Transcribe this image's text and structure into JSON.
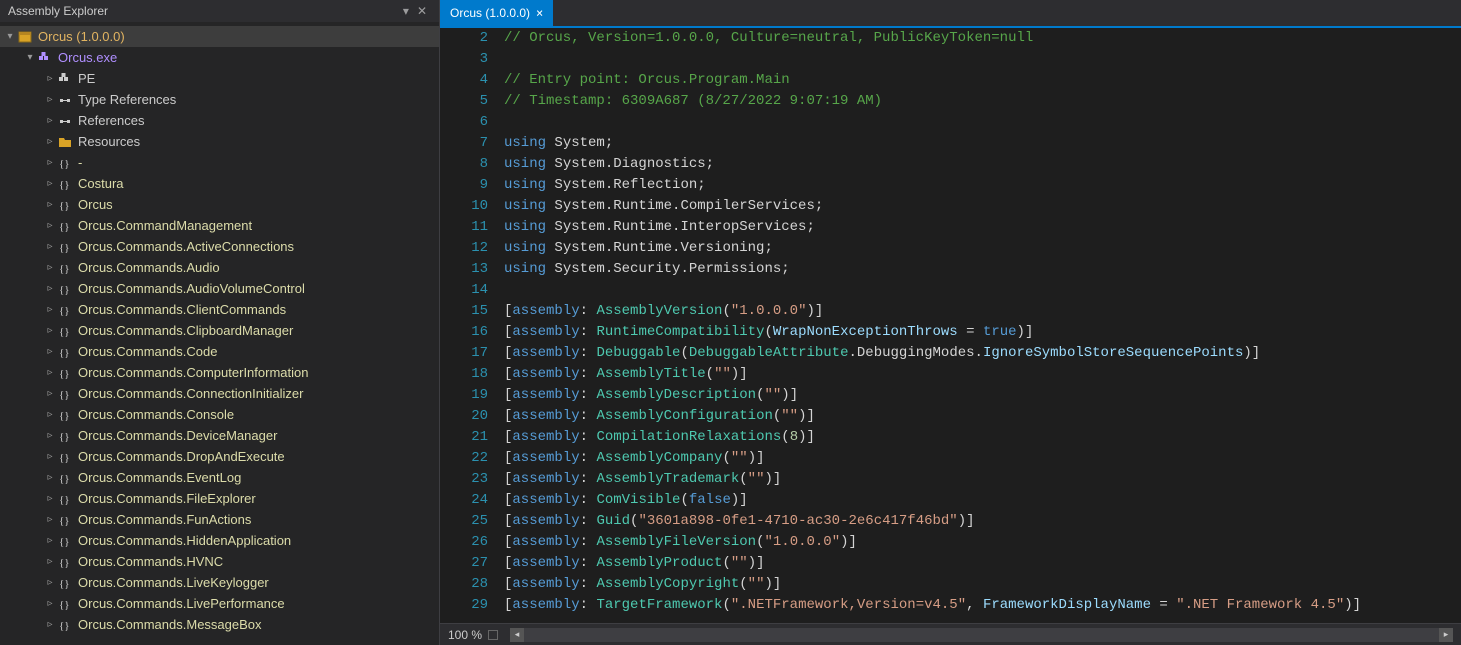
{
  "explorer": {
    "title": "Assembly Explorer",
    "root": {
      "label": "Orcus (1.0.0.0)",
      "exe": "Orcus.exe",
      "children": [
        {
          "label": "PE",
          "kind": "pe"
        },
        {
          "label": "Type References",
          "kind": "ref"
        },
        {
          "label": "References",
          "kind": "ref"
        },
        {
          "label": "Resources",
          "kind": "folder"
        },
        {
          "label": "-",
          "kind": "ns"
        },
        {
          "label": "Costura",
          "kind": "ns"
        },
        {
          "label": "Orcus",
          "kind": "ns"
        },
        {
          "label": "Orcus.CommandManagement",
          "kind": "ns"
        },
        {
          "label": "Orcus.Commands.ActiveConnections",
          "kind": "ns"
        },
        {
          "label": "Orcus.Commands.Audio",
          "kind": "ns"
        },
        {
          "label": "Orcus.Commands.AudioVolumeControl",
          "kind": "ns"
        },
        {
          "label": "Orcus.Commands.ClientCommands",
          "kind": "ns"
        },
        {
          "label": "Orcus.Commands.ClipboardManager",
          "kind": "ns"
        },
        {
          "label": "Orcus.Commands.Code",
          "kind": "ns"
        },
        {
          "label": "Orcus.Commands.ComputerInformation",
          "kind": "ns"
        },
        {
          "label": "Orcus.Commands.ConnectionInitializer",
          "kind": "ns"
        },
        {
          "label": "Orcus.Commands.Console",
          "kind": "ns"
        },
        {
          "label": "Orcus.Commands.DeviceManager",
          "kind": "ns"
        },
        {
          "label": "Orcus.Commands.DropAndExecute",
          "kind": "ns"
        },
        {
          "label": "Orcus.Commands.EventLog",
          "kind": "ns"
        },
        {
          "label": "Orcus.Commands.FileExplorer",
          "kind": "ns"
        },
        {
          "label": "Orcus.Commands.FunActions",
          "kind": "ns"
        },
        {
          "label": "Orcus.Commands.HiddenApplication",
          "kind": "ns"
        },
        {
          "label": "Orcus.Commands.HVNC",
          "kind": "ns"
        },
        {
          "label": "Orcus.Commands.LiveKeylogger",
          "kind": "ns"
        },
        {
          "label": "Orcus.Commands.LivePerformance",
          "kind": "ns"
        },
        {
          "label": "Orcus.Commands.MessageBox",
          "kind": "ns"
        }
      ]
    }
  },
  "tab": {
    "label": "Orcus (1.0.0.0)"
  },
  "status": {
    "zoom": "100 %"
  },
  "code": [
    {
      "n": 2,
      "t": "comment",
      "text": "// Orcus, Version=1.0.0.0, Culture=neutral, PublicKeyToken=null"
    },
    {
      "n": 3,
      "t": "blank",
      "text": ""
    },
    {
      "n": 4,
      "t": "comment",
      "text": "// Entry point: Orcus.Program.Main"
    },
    {
      "n": 5,
      "t": "comment",
      "text": "// Timestamp: 6309A687 (8/27/2022 9:07:19 AM)"
    },
    {
      "n": 6,
      "t": "blank",
      "text": ""
    },
    {
      "n": 7,
      "t": "using",
      "ns": "System"
    },
    {
      "n": 8,
      "t": "using",
      "ns": "System.Diagnostics"
    },
    {
      "n": 9,
      "t": "using",
      "ns": "System.Reflection"
    },
    {
      "n": 10,
      "t": "using",
      "ns": "System.Runtime.CompilerServices"
    },
    {
      "n": 11,
      "t": "using",
      "ns": "System.Runtime.InteropServices"
    },
    {
      "n": 12,
      "t": "using",
      "ns": "System.Runtime.Versioning"
    },
    {
      "n": 13,
      "t": "using",
      "ns": "System.Security.Permissions"
    },
    {
      "n": 14,
      "t": "blank",
      "text": ""
    },
    {
      "n": 15,
      "t": "attr",
      "name": "AssemblyVersion",
      "args": [
        {
          "k": "str",
          "v": "\"1.0.0.0\""
        }
      ]
    },
    {
      "n": 16,
      "t": "attr",
      "name": "RuntimeCompatibility",
      "args": [
        {
          "k": "assign",
          "param": "WrapNonExceptionThrows",
          "v": "true",
          "vk": "bool"
        }
      ]
    },
    {
      "n": 17,
      "t": "attr",
      "name": "Debuggable",
      "args": [
        {
          "k": "enum",
          "owner": "DebuggableAttribute",
          "member": "DebuggingModes",
          "value": "IgnoreSymbolStoreSequencePoints"
        }
      ]
    },
    {
      "n": 18,
      "t": "attr",
      "name": "AssemblyTitle",
      "args": [
        {
          "k": "str",
          "v": "\"\""
        }
      ]
    },
    {
      "n": 19,
      "t": "attr",
      "name": "AssemblyDescription",
      "args": [
        {
          "k": "str",
          "v": "\"\""
        }
      ]
    },
    {
      "n": 20,
      "t": "attr",
      "name": "AssemblyConfiguration",
      "args": [
        {
          "k": "str",
          "v": "\"\""
        }
      ]
    },
    {
      "n": 21,
      "t": "attr",
      "name": "CompilationRelaxations",
      "args": [
        {
          "k": "num",
          "v": "8"
        }
      ]
    },
    {
      "n": 22,
      "t": "attr",
      "name": "AssemblyCompany",
      "args": [
        {
          "k": "str",
          "v": "\"\""
        }
      ]
    },
    {
      "n": 23,
      "t": "attr",
      "name": "AssemblyTrademark",
      "args": [
        {
          "k": "str",
          "v": "\"\""
        }
      ]
    },
    {
      "n": 24,
      "t": "attr",
      "name": "ComVisible",
      "args": [
        {
          "k": "bool",
          "v": "false"
        }
      ]
    },
    {
      "n": 25,
      "t": "attr",
      "name": "Guid",
      "args": [
        {
          "k": "str",
          "v": "\"3601a898-0fe1-4710-ac30-2e6c417f46bd\""
        }
      ]
    },
    {
      "n": 26,
      "t": "attr",
      "name": "AssemblyFileVersion",
      "args": [
        {
          "k": "str",
          "v": "\"1.0.0.0\""
        }
      ]
    },
    {
      "n": 27,
      "t": "attr",
      "name": "AssemblyProduct",
      "args": [
        {
          "k": "str",
          "v": "\"\""
        }
      ]
    },
    {
      "n": 28,
      "t": "attr",
      "name": "AssemblyCopyright",
      "args": [
        {
          "k": "str",
          "v": "\"\""
        }
      ]
    },
    {
      "n": 29,
      "t": "attr",
      "name": "TargetFramework",
      "args": [
        {
          "k": "str",
          "v": "\".NETFramework,Version=v4.5\""
        },
        {
          "k": "assign",
          "param": "FrameworkDisplayName",
          "v": "\".NET Framework 4.5\"",
          "vk": "str"
        }
      ]
    }
  ]
}
